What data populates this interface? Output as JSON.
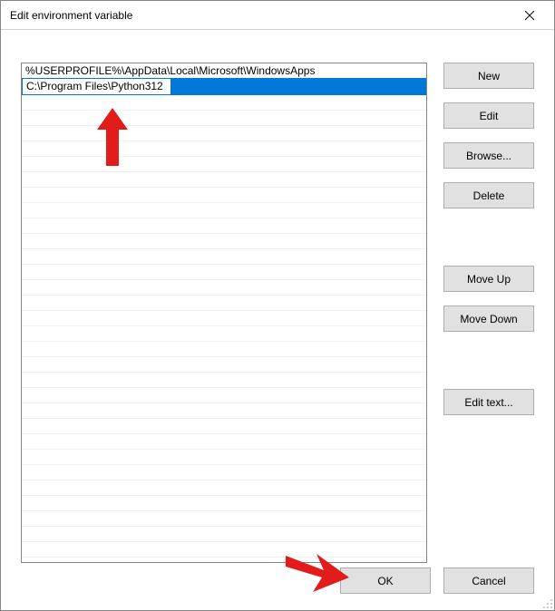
{
  "window": {
    "title": "Edit environment variable",
    "close_icon": "close"
  },
  "entries": [
    "%USERPROFILE%\\AppData\\Local\\Microsoft\\WindowsApps"
  ],
  "editing_value": "C:\\Program Files\\Python312",
  "buttons": {
    "new": "New",
    "edit": "Edit",
    "browse": "Browse...",
    "delete": "Delete",
    "move_up": "Move Up",
    "move_down": "Move Down",
    "edit_text": "Edit text...",
    "ok": "OK",
    "cancel": "Cancel"
  },
  "empty_rows": 31
}
